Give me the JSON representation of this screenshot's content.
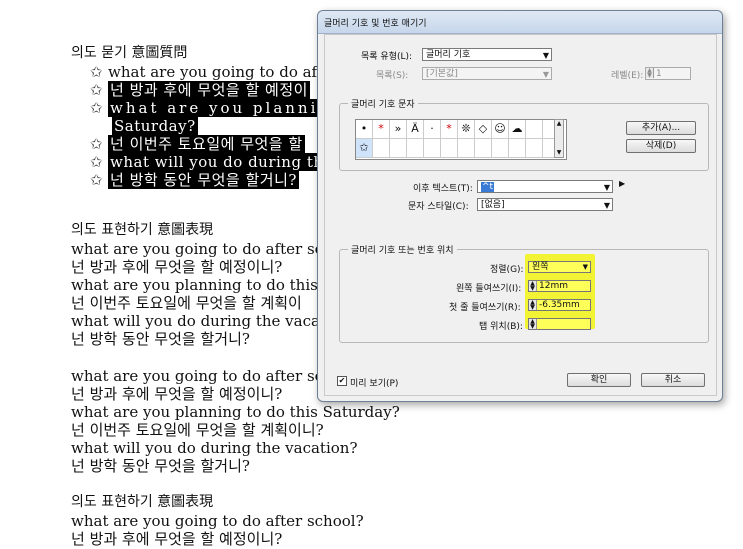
{
  "document": {
    "section1_heading": "의도 묻기 意圖質問",
    "bullets": [
      "what are you going to do aft",
      "넌 방과 후에 무엇을 할 예정이",
      "what are you planning",
      "Saturday?",
      "넌 이번주 토요일에 무엇을 할",
      "what will you do during the",
      "넌 방학 동안 무엇을 할거니?"
    ],
    "bullet_icon": "outline-star-icon",
    "section2_heading": "의도 표현하기 意圖表現",
    "section2_lines": [
      "what are you going to do after scho",
      "넌 방과 후에 무엇을 할 예정이니?",
      "what are you planning to do this S",
      "넌 이번주 토요일에 무엇을 할 계획이",
      "what will you do during the vacati",
      "넌 방학 동안 무엇을 할거니?"
    ],
    "section3_lines": [
      "what are you going to do after sch",
      "넌 방과 후에 무엇을 할 예정이니?",
      "what are you planning to do this Saturday?",
      "넌 이번주 토요일에 무엇을 할 계획이니?",
      "what will you do during the vacation?",
      "넌 방학 동안 무엇을 할거니?"
    ],
    "section4_heading": "의도 표현하기 意圖表現",
    "section4_lines": [
      "what are you going to do after school?",
      "넌 방과 후에 무엇을 할 예정이니?"
    ]
  },
  "dialog": {
    "title": "글머리 기호 및 번호 매기기",
    "list_type_label": "목록 유형(L):",
    "list_type_value": "글머리 기호",
    "list_label": "목록(S):",
    "list_value": "[기본값]",
    "level_label": "레벨(E):",
    "level_value": "1",
    "bullet_char_group": "글머리 기호 문자",
    "bullet_chars": [
      "•",
      "*",
      "»",
      "Ä",
      "·",
      "*",
      "❊",
      "◇",
      "☺",
      "☁",
      "✩"
    ],
    "add_button": "추가(A)...",
    "delete_button": "삭제(D)",
    "text_after_label": "이후 텍스트(T):",
    "text_after_value": "^t",
    "char_style_label": "문자 스타일(C):",
    "char_style_value": "[없음]",
    "position_group": "글머리 기호 또는 번호 위치",
    "alignment_label": "정렬(G):",
    "alignment_value": "왼쪽",
    "left_indent_label": "왼쪽 들여쓰기(I):",
    "left_indent_value": "12mm",
    "first_indent_label": "첫 줄 들여쓰기(R):",
    "first_indent_value": "-6.35mm",
    "tab_position_label": "탭 위치(B):",
    "tab_position_value": "",
    "preview_label": "미리 보기(P)",
    "preview_checked": "✔",
    "ok_button": "확인",
    "cancel_button": "취소",
    "highlight_color": "#f3f336"
  }
}
